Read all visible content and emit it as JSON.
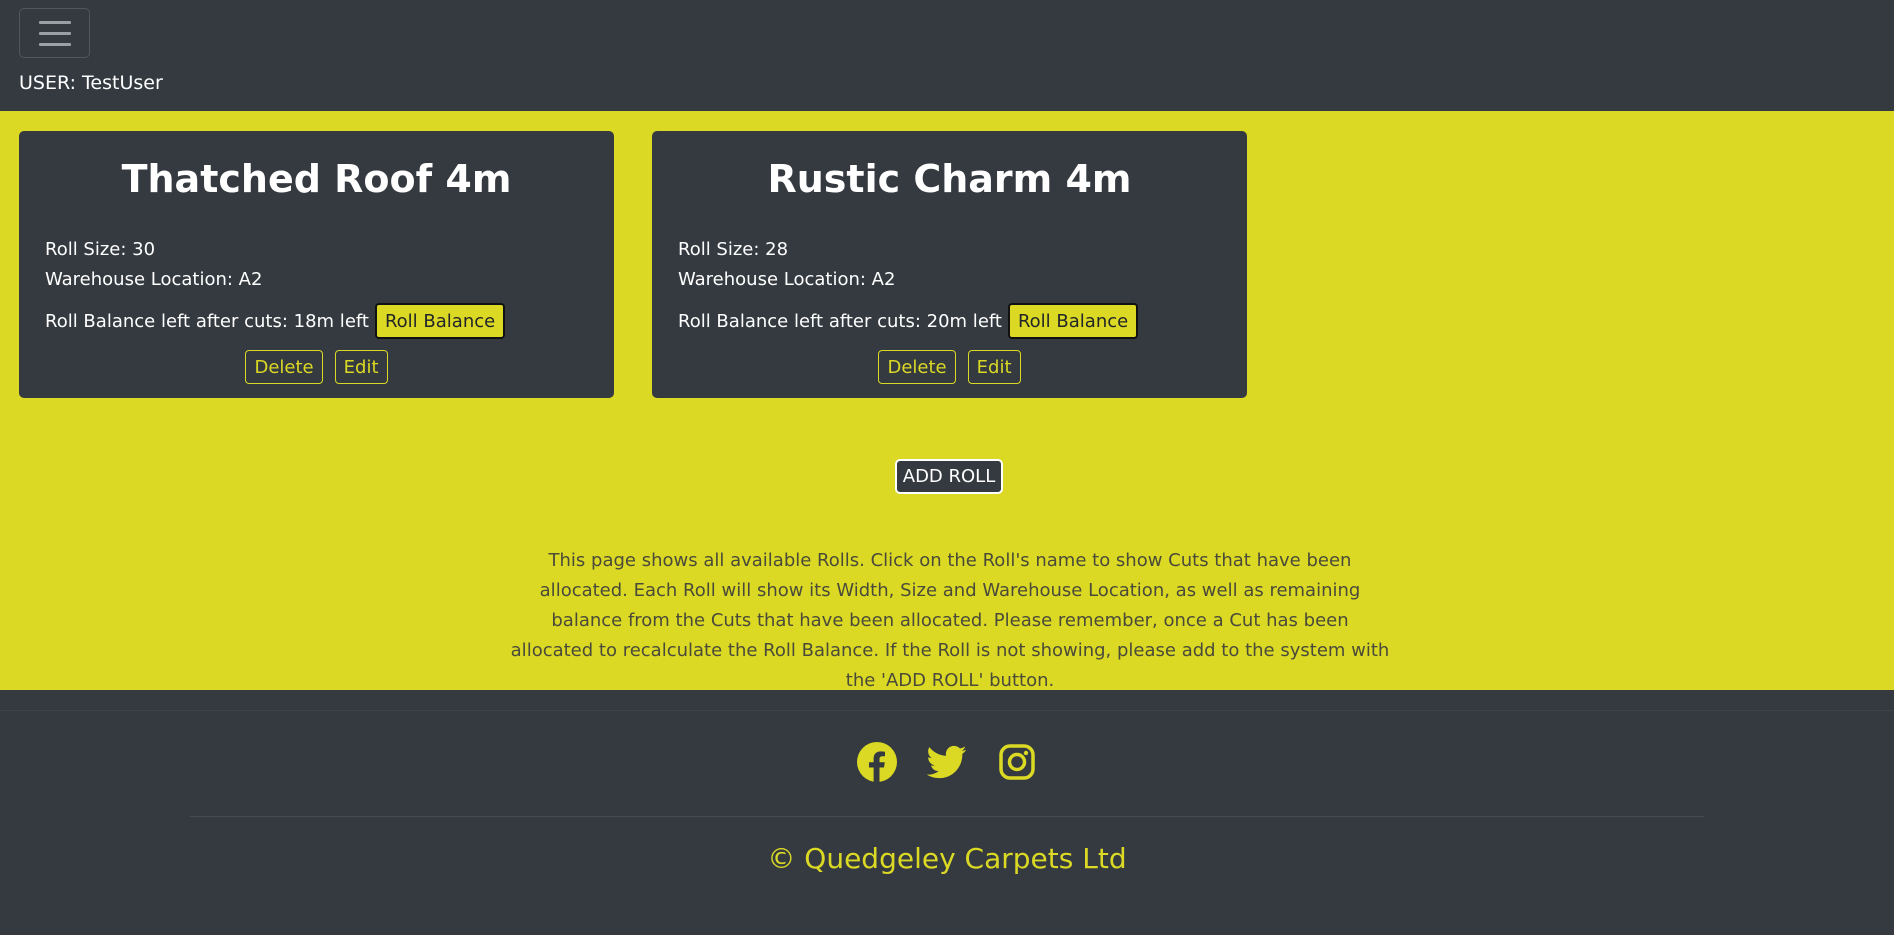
{
  "header": {
    "user_label": "USER: TestUser"
  },
  "rolls": [
    {
      "name": "Thatched Roof 4m",
      "roll_size": "Roll Size: 30",
      "warehouse": "Warehouse Location: A2",
      "balance": "Roll Balance left after cuts: 18m left",
      "balance_button": "Roll Balance",
      "delete_label": "Delete",
      "edit_label": "Edit"
    },
    {
      "name": "Rustic Charm 4m",
      "roll_size": "Roll Size: 28",
      "warehouse": "Warehouse Location: A2",
      "balance": "Roll Balance left after cuts: 20m left",
      "balance_button": "Roll Balance",
      "delete_label": "Delete",
      "edit_label": "Edit"
    }
  ],
  "main": {
    "add_roll_label": "ADD ROLL",
    "info_text": "This page shows all available Rolls. Click on the Roll's name to show Cuts that have been allocated. Each Roll will show its Width, Size and Warehouse Location, as well as remaining balance from the Cuts that have been allocated. Please remember, once a Cut has been allocated to recalculate the Roll Balance. If the Roll is not showing, please add to the system with the 'ADD ROLL' button."
  },
  "footer": {
    "social_icons": [
      "facebook-icon",
      "twitter-icon",
      "instagram-icon"
    ],
    "copyright": "© Quedgeley Carpets Ltd"
  },
  "colors": {
    "dark": "#343a40",
    "accent": "#dbd924",
    "text_light": "#ffffff"
  }
}
